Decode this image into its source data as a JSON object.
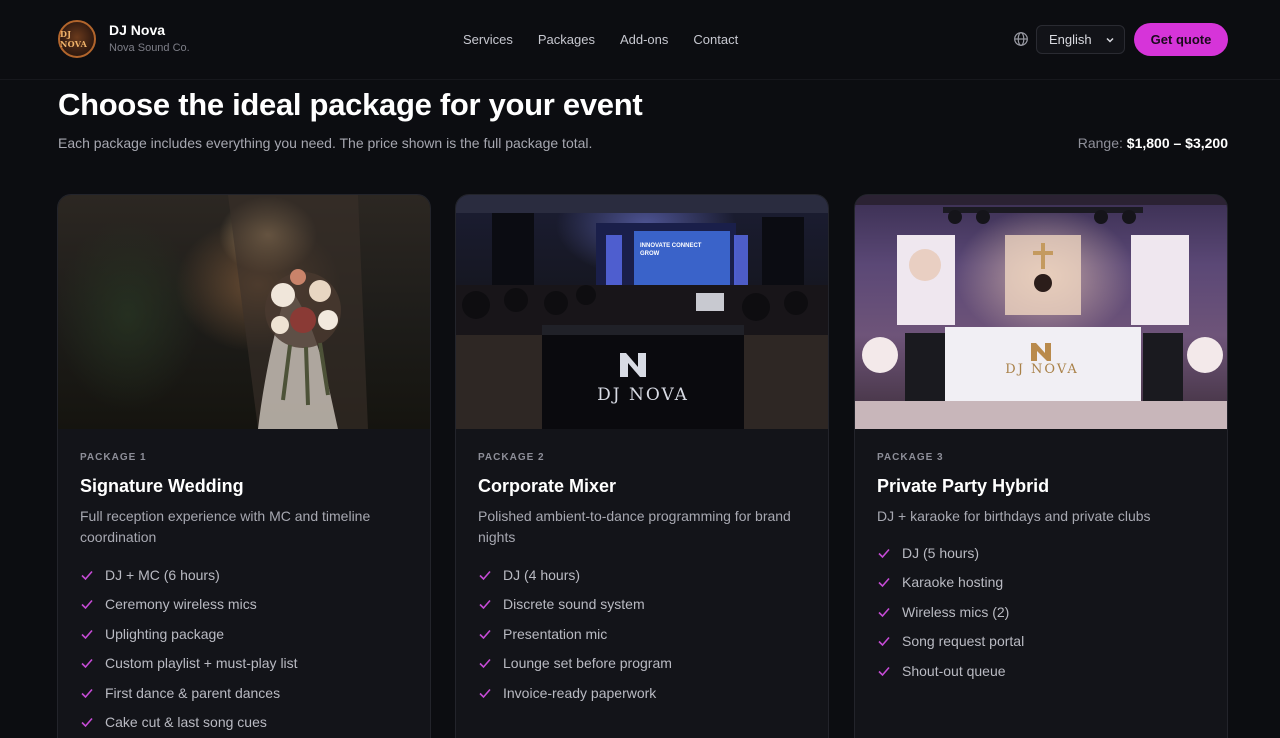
{
  "brand": {
    "name": "DJ Nova",
    "subtitle": "Nova Sound Co.",
    "logo_text": "DJ NOVA"
  },
  "nav": {
    "items": [
      "Services",
      "Packages",
      "Add-ons",
      "Contact"
    ]
  },
  "header": {
    "language": "English",
    "cta_label": "Get quote",
    "accent_color": "#d634d9"
  },
  "hero": {
    "title": "Choose the ideal package for your event",
    "subtitle": "Each package includes everything you need. The price shown is the full package total.",
    "range_label": "Range:",
    "range_value": "$1,800 – $3,200"
  },
  "packages": [
    {
      "number": "PACKAGE 1",
      "title": "Signature Wedding",
      "description": "Full reception experience with MC and timeline coordination",
      "features": [
        "DJ + MC (6 hours)",
        "Ceremony wireless mics",
        "Uplighting package",
        "Custom playlist + must-play list",
        "First dance & parent dances",
        "Cake cut & last song cues"
      ]
    },
    {
      "number": "PACKAGE 2",
      "title": "Corporate Mixer",
      "description": "Polished ambient-to-dance programming for brand nights",
      "screen_text": "INNOVATE CONNECT GROW",
      "booth_text": "DJ NOVA",
      "features": [
        "DJ (4 hours)",
        "Discrete sound system",
        "Presentation mic",
        "Lounge set before program",
        "Invoice-ready paperwork"
      ]
    },
    {
      "number": "PACKAGE 3",
      "title": "Private Party Hybrid",
      "description": "DJ + karaoke for birthdays and private clubs",
      "booth_text": "DJ NOVA",
      "features": [
        "DJ (5 hours)",
        "Karaoke hosting",
        "Wireless mics (2)",
        "Song request portal",
        "Shout-out queue"
      ]
    }
  ]
}
